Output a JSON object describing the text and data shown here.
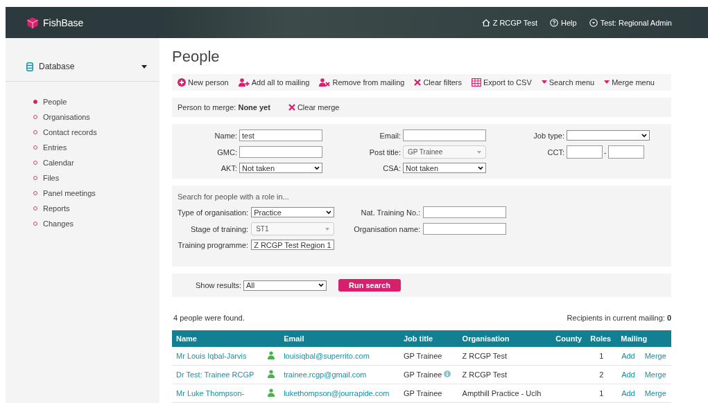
{
  "header": {
    "brand": "FishBase",
    "links": [
      {
        "label": "Z RCGP Test"
      },
      {
        "label": "Help"
      },
      {
        "label": "Test: Regional Admin"
      }
    ]
  },
  "sidebar": {
    "title": "Database",
    "items": [
      {
        "label": "People",
        "selected": true
      },
      {
        "label": "Organisations",
        "selected": false
      },
      {
        "label": "Contact records",
        "selected": false
      },
      {
        "label": "Entries",
        "selected": false
      },
      {
        "label": "Calendar",
        "selected": false
      },
      {
        "label": "Files",
        "selected": false
      },
      {
        "label": "Panel meetings",
        "selected": false
      },
      {
        "label": "Reports",
        "selected": false
      },
      {
        "label": "Changes",
        "selected": false
      }
    ]
  },
  "page_title": "People",
  "toolbar": [
    {
      "label": "New person"
    },
    {
      "label": "Add all to mailing"
    },
    {
      "label": "Remove from mailing"
    },
    {
      "label": "Clear filters"
    },
    {
      "label": "Export to CSV"
    },
    {
      "label": "Search menu"
    },
    {
      "label": "Merge menu"
    }
  ],
  "merge": {
    "label": "Person to merge:",
    "value": "None yet",
    "clear": "Clear merge"
  },
  "filters": [
    {
      "label": "Name:",
      "kind": "text",
      "value": "test"
    },
    {
      "label": "Email:",
      "kind": "text"
    },
    {
      "label": "Job type:",
      "kind": "select"
    },
    {
      "label": "GMC:",
      "kind": "text"
    },
    {
      "label": "Post title:",
      "kind": "combo",
      "value": "GP Trainee"
    },
    {
      "label": "CCT:",
      "kind": "range",
      "separator": "-"
    },
    {
      "label": "AKT:",
      "kind": "select",
      "value": "Not taken"
    },
    {
      "label": "CSA:",
      "kind": "select",
      "value": "Not taken"
    }
  ],
  "role_search": {
    "heading": "Search for people with a role in...",
    "fields": [
      {
        "label": "Type of organisation:",
        "kind": "select",
        "value": "Practice"
      },
      {
        "label": "Nat. Training No.:",
        "kind": "text"
      },
      {
        "label": "Stage of training:",
        "kind": "combo",
        "value": "ST1"
      },
      {
        "label": "Organisation name:",
        "kind": "text"
      },
      {
        "label": "Training programme:",
        "kind": "select",
        "value": "Z RCGP Test Region 1"
      }
    ]
  },
  "results_bar": {
    "label": "Show results:",
    "value": "All",
    "button": "Run search"
  },
  "summary": {
    "found": "4 people were found.",
    "mailing_label": "Recipients in current mailing:",
    "mailing_count": "0"
  },
  "table": {
    "columns": [
      "Name",
      "Email",
      "Job title",
      "Organisation",
      "County",
      "Roles",
      "Mailing"
    ],
    "rows": [
      {
        "name": "Mr Louis Iqbal-Jarvis",
        "email": "louisiqbal@superrito.com",
        "job_title": "GP Trainee",
        "info": false,
        "organisation": "Z RCGP Test",
        "roles": "1",
        "mailing": "Add",
        "merge": "Merge"
      },
      {
        "name": "Dr Test: Trainee RCGP",
        "email": "trainee.rcgp@gmail.com",
        "job_title": "GP Trainee",
        "info": true,
        "organisation": "Z RCGP Test",
        "roles": "2",
        "mailing": "Add",
        "merge": "Merge"
      },
      {
        "name": "Mr Luke Thompson-",
        "email": "lukethompson@jourrapide.com",
        "job_title": "GP Trainee",
        "info": false,
        "organisation": "Ampthill Practice - Uclh",
        "roles": "1",
        "mailing": "Add",
        "merge": "Merge"
      }
    ]
  }
}
